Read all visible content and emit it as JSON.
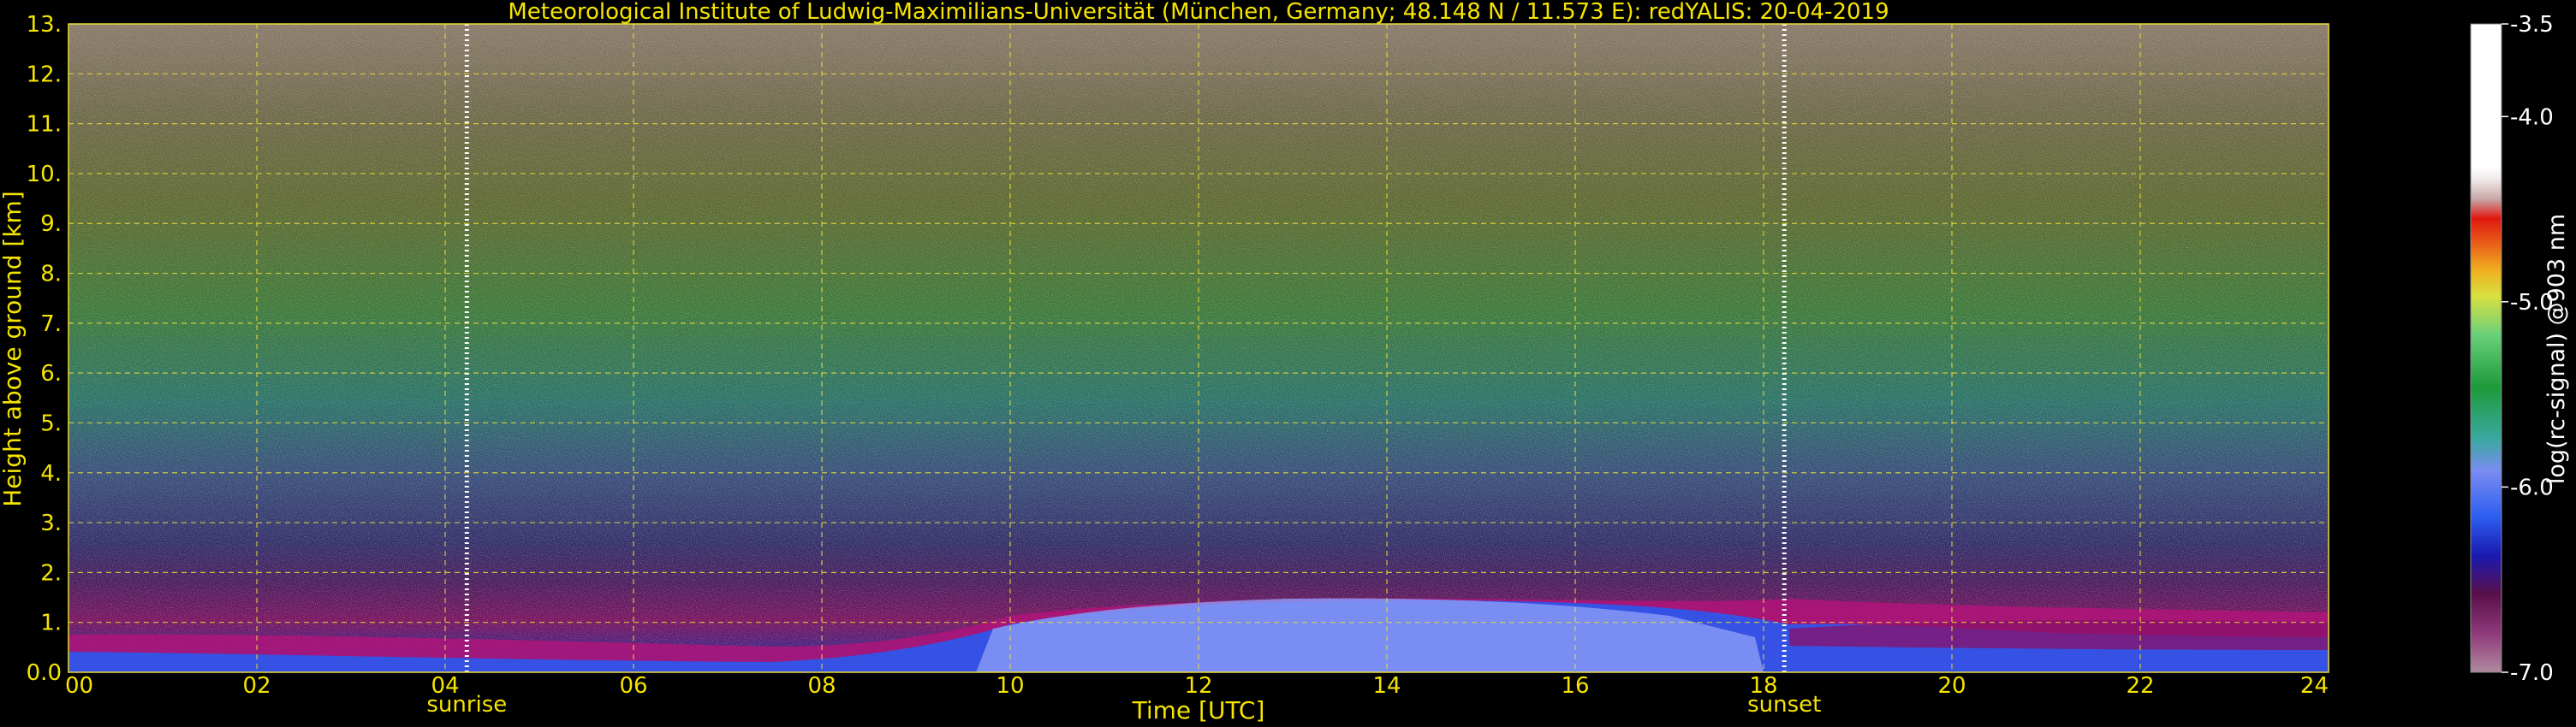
{
  "chart_data": {
    "type": "heatmap",
    "title": "Meteorological Institute of Ludwig-Maximilians-Universität (München, Germany; 48.148 N / 11.573 E):    redYALIS: 20-04-2019",
    "xlabel": "Time [UTC]",
    "ylabel": "Height above ground [km]",
    "colorbar_label": "log(rc-signal) @903 nm",
    "xlim": [
      0,
      24
    ],
    "ylim": [
      0,
      13
    ],
    "x_ticks": [
      "00",
      "02",
      "04",
      "06",
      "08",
      "10",
      "12",
      "14",
      "16",
      "18",
      "20",
      "22",
      "24"
    ],
    "y_ticks": [
      "0.0",
      "1.",
      "2.",
      "3.",
      "4.",
      "5.",
      "6.",
      "7.",
      "8.",
      "9.",
      "10.",
      "11.",
      "12.",
      "13."
    ],
    "clim": [
      -7.0,
      -3.5
    ],
    "colorbar_ticks": [
      "-3.5",
      "-4.0",
      "-5.0",
      "-6.0",
      "-7.0"
    ],
    "colorbar_tick_values": [
      -3.5,
      -4.0,
      -5.0,
      -6.0,
      -7.0
    ],
    "grid": true,
    "events": [
      {
        "label": "sunrise",
        "time": 4.23
      },
      {
        "label": "sunset",
        "time": 18.22
      }
    ],
    "colors": {
      "text": "#f5e400",
      "grid": "#e8dc3a",
      "background": "#000000"
    }
  }
}
